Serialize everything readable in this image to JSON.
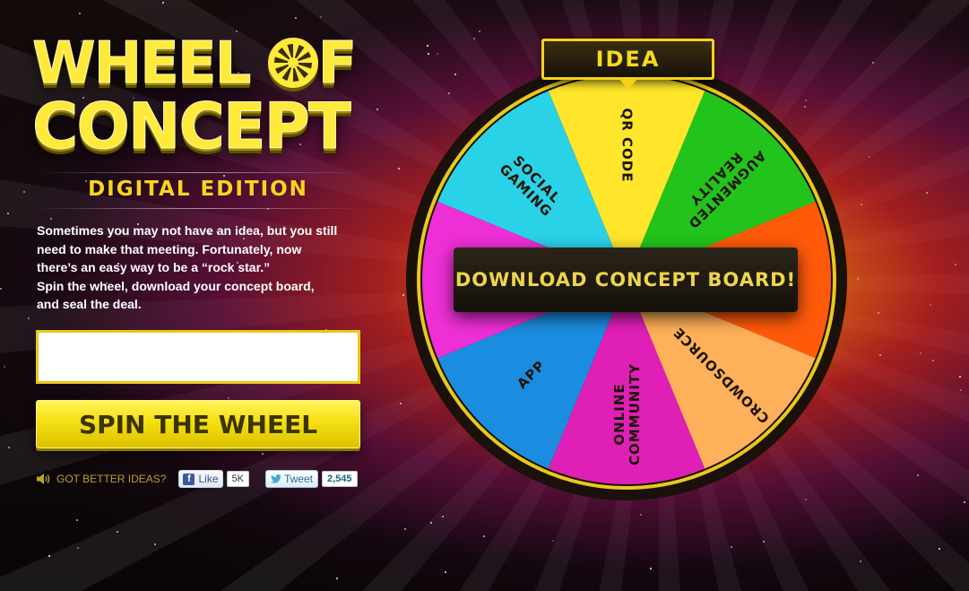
{
  "logo": {
    "line1_a": "WHEEL ",
    "line1_b": "F",
    "line2": "CONCEPT"
  },
  "edition": "DIGITAL EDITION",
  "description": {
    "lines": [
      "Sometimes you may not have an idea, but you still",
      "need to make that meeting. Fortunately, now",
      "there’s an easy way to be a “rock star.”",
      "Spin the wheel, download your concept board,",
      "and seal the deal."
    ]
  },
  "concept_input": {
    "value": "",
    "placeholder": ""
  },
  "spin_button": "SPIN THE WHEEL",
  "social": {
    "prompt": "GOT BETTER IDEAS?",
    "fb_like_label": "Like",
    "fb_like_count": "5K",
    "tweet_label": "Tweet",
    "tweet_count": "2,545"
  },
  "wheel": {
    "pointer_label": "IDEA",
    "download_button": "DOWNLOAD CONCEPT BOARD!",
    "segments": [
      {
        "label": "QR CODE",
        "color": "#ffe62a"
      },
      {
        "label": "AUGMENTED REALITY",
        "color": "#22c41c"
      },
      {
        "label": "",
        "color": "#ff5a0a"
      },
      {
        "label": "CROWDSOURCE",
        "color": "#ffb05a"
      },
      {
        "label": "ONLINE COMMUNITY",
        "color": "#e01fb6"
      },
      {
        "label": "APP",
        "color": "#1b8de0"
      },
      {
        "label": "",
        "color": "#ee2fd6"
      },
      {
        "label": "SOCIAL GAMING",
        "color": "#2ad2e8"
      }
    ]
  },
  "colors": {
    "accent_yellow": "#f7d91f",
    "text_gold": "#b7a326",
    "wheel_rim": "#1a120a"
  },
  "icons": {
    "speaker": "speaker-icon",
    "facebook": "facebook-icon",
    "twitter": "twitter-bird-icon",
    "logo_wheel": "wheel-o-icon"
  }
}
